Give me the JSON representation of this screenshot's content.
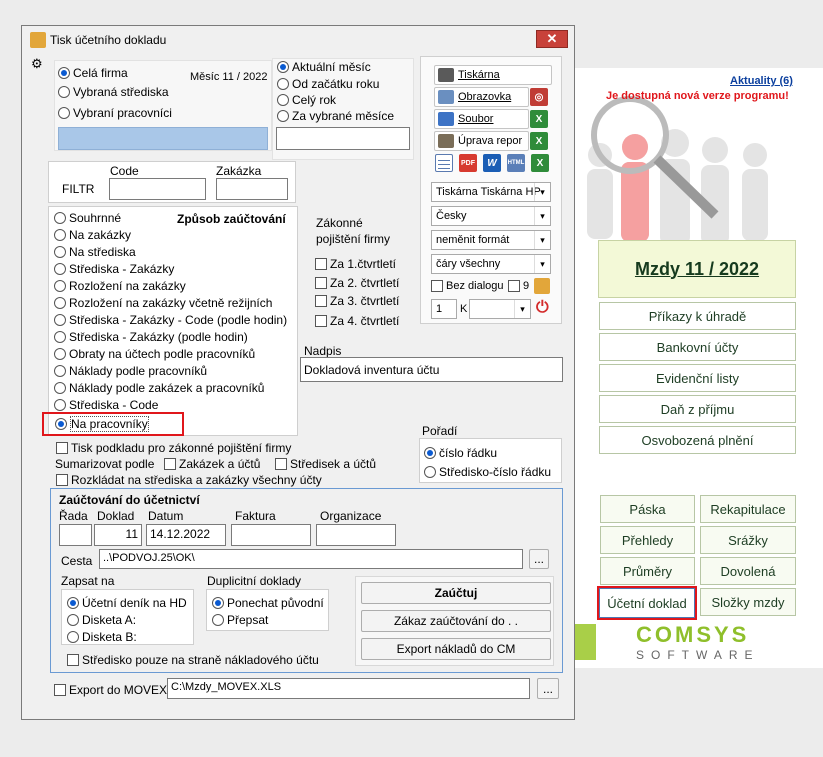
{
  "window": {
    "title": "Tisk účetního dokladu",
    "close": "✕"
  },
  "scope": {
    "options": [
      "Celá firma",
      "Vybraná střediska",
      "Vybraní pracovníci"
    ],
    "selected": 0,
    "month_label": "Měsíc 11 / 2022"
  },
  "period": {
    "options": [
      "Aktuální měsíc",
      "Od začátku roku",
      "Celý rok",
      "Za vybrané měsíce"
    ],
    "selected": 0
  },
  "filter": {
    "label": "FILTR",
    "code_label": "Code",
    "zakazka_label": "Zakázka",
    "code_value": "",
    "zakazka_value": ""
  },
  "booking_method": {
    "heading": "Způsob zaúčtování",
    "options": [
      "Souhrnné",
      "Na zakázky",
      "Na střediska",
      "Střediska - Zakázky",
      "Rozložení na zakázky",
      "Rozložení na zakázky včetně režijních",
      "Střediska - Zakázky - Code (podle hodin)",
      "Střediska - Zakázky (podle hodin)",
      "Obraty na účtech podle pracovníků",
      "Náklady podle pracovníků",
      "Náklady podle zakázek a pracovníků",
      "Střediska - Code",
      "Na pracovníky"
    ],
    "selected": 12
  },
  "insurance": {
    "heading_1": "Zákonné",
    "heading_2": "pojištění firmy",
    "quarters": [
      "Za 1.čtvrtletí",
      "Za 2. čtvrtletí",
      "Za 3. čtvrtletí",
      "Za 4. čtvrtletí"
    ]
  },
  "output": {
    "printer": "Tiskárna",
    "screen": "Obrazovka",
    "file": "Soubor",
    "edit_report": "Úprava repor",
    "printer_select": "Tiskárna Tiskárna HP",
    "language_select": "Česky",
    "format_select": "neměnit formát",
    "lines_select": "čáry všechny",
    "no_dialog": "Bez dialogu",
    "nine": "9",
    "copies": "1",
    "k": "K",
    "pdf": "PDF",
    "word": "W",
    "html": "HTML",
    "xl": "X"
  },
  "heading": {
    "label": "Nadpis",
    "value": "Dokladová inventura účtu"
  },
  "order": {
    "label": "Pořadí",
    "options": [
      "číslo řádku",
      "Středisko-číslo řádku"
    ],
    "selected": 0
  },
  "print_options": {
    "print_basis": "Tisk podkladu pro zákonné pojištění firmy",
    "summarize_by": "Sumarizovat podle",
    "by_orders": "Zakázek a účtů",
    "by_centers": "Středisek a účtů",
    "split": "Rozkládat na střediska a zakázky všechny účty"
  },
  "accounting": {
    "title": "Zaúčtování do účetnictví",
    "rada_label": "Řada",
    "doklad_label": "Doklad",
    "datum_label": "Datum",
    "faktura_label": "Faktura",
    "organizace_label": "Organizace",
    "rada": "",
    "doklad": "11",
    "datum": "14.12.2022",
    "faktura": "",
    "organizace": "",
    "cesta_label": "Cesta",
    "cesta": "..\\PODVOJ.25\\OK\\",
    "browse": "...",
    "zapsat_label": "Zapsat na",
    "zapsat_options": [
      "Účetní deník na HD",
      "Disketa A:",
      "Disketa B:"
    ],
    "zapsat_selected": 0,
    "dup_label": "Duplicitní doklady",
    "dup_options": [
      "Ponechat původní",
      "Přepsat"
    ],
    "dup_selected": 0,
    "btn_book": "Zaúčtuj",
    "btn_forbid": "Zákaz zaúčtování do  .  .",
    "btn_export": "Export nákladů do CM",
    "stredisko_only": "Středisko pouze na straně nákladového účtu"
  },
  "movex": {
    "label": "Export do MOVEX",
    "path": "C:\\Mzdy_MOVEX.XLS",
    "browse": "..."
  },
  "background": {
    "news": "Aktuality (6)",
    "new_version": "Je dostupná nová verze programu!",
    "title": "Mzdy 11 / 2022",
    "menu": [
      "Příkazy k úhradě",
      "Bankovní účty",
      "Evidenční listy",
      "Daň z příjmu",
      "Osvobozená plnění"
    ],
    "grid": [
      "Páska",
      "Rekapitulace",
      "Přehledy",
      "Srážky",
      "Průměry",
      "Dovolená",
      "Účetní doklad",
      "Složky mzdy"
    ],
    "logo_top": "COMSYS",
    "logo_bottom": "SOFTWARE"
  },
  "colors": {
    "accent": "#0a5ad1",
    "highlight": "#e0161b",
    "scope_bar": "#a9c7e8",
    "brand_green": "#a9cf48"
  }
}
